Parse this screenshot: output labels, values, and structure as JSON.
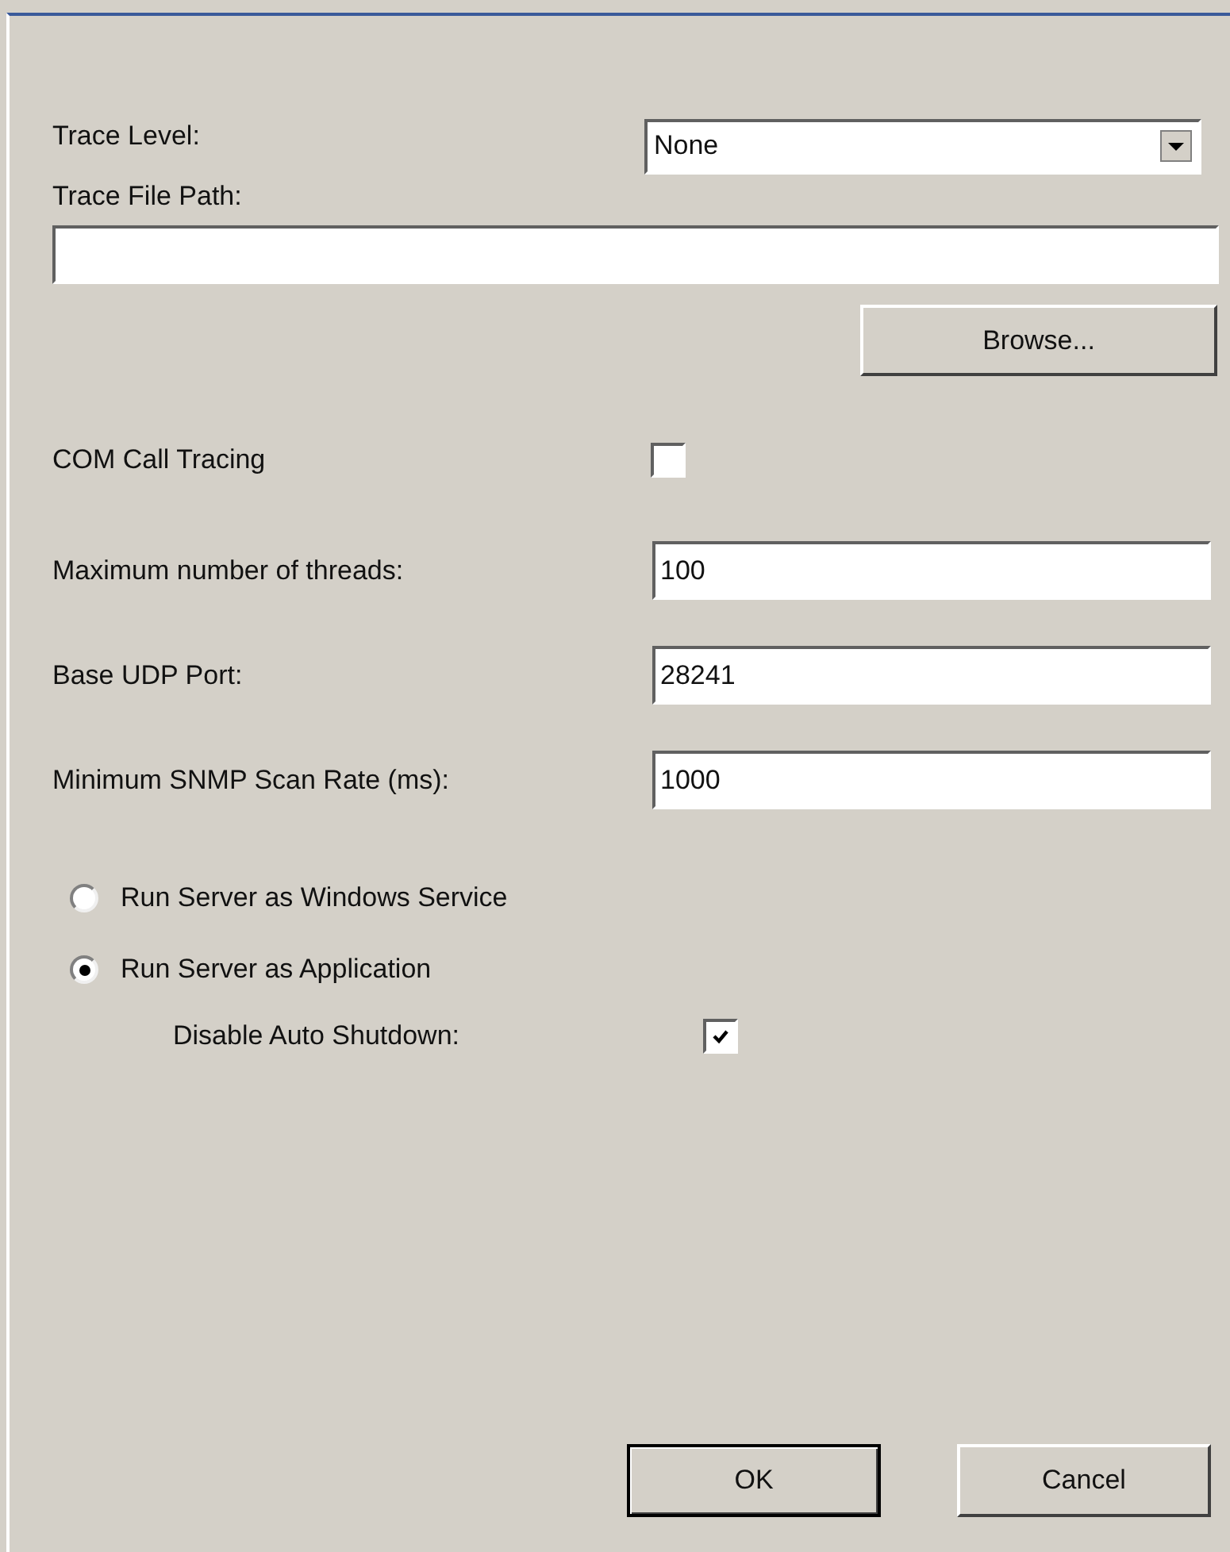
{
  "trace_level": {
    "label": "Trace Level:",
    "value": "None"
  },
  "trace_file_path": {
    "label": "Trace File Path:"
  },
  "browse_button": "Browse...",
  "com_call_tracing": {
    "label": "COM Call Tracing",
    "checked": false
  },
  "fields": [
    {
      "label": "Maximum number of threads:",
      "value": "100"
    },
    {
      "label": "Base UDP Port:",
      "value": "28241"
    },
    {
      "label": "Minimum SNMP Scan Rate (ms):",
      "value": "1000"
    }
  ],
  "run_mode": [
    {
      "label": "Run Server as Windows Service",
      "selected": false
    },
    {
      "label": "Run Server as Application",
      "selected": true
    }
  ],
  "disable_auto_shutdown": {
    "label": "Disable Auto Shutdown:",
    "checked": true
  },
  "buttons": [
    {
      "label": "OK",
      "default": true
    },
    {
      "label": "Cancel",
      "default": false
    }
  ]
}
